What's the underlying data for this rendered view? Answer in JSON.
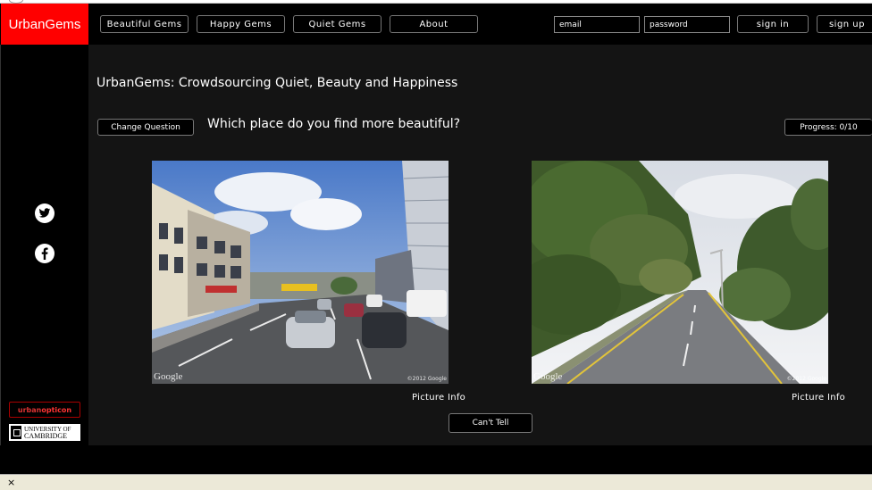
{
  "brand": {
    "name": "UrbanGems"
  },
  "nav": {
    "items": [
      {
        "label": "Beautiful Gems"
      },
      {
        "label": "Happy Gems"
      },
      {
        "label": "Quiet Gems"
      },
      {
        "label": "About"
      }
    ]
  },
  "auth": {
    "email_value": "email",
    "password_value": "password",
    "signin_label": "sign in",
    "signup_label": "sign up"
  },
  "social": {
    "twitter_icon": "twitter-icon",
    "facebook_icon": "facebook-icon"
  },
  "main": {
    "title": "UrbanGems: Crowdsourcing Quiet, Beauty and Happiness",
    "change_question_label": "Change Question",
    "question": "Which place do you find more beautiful?",
    "progress_label": "Progress: 0/10",
    "left_picture": {
      "watermark": "Google",
      "copyright": "©2012 Google",
      "info_label": "Picture Info"
    },
    "right_picture": {
      "watermark": "Google",
      "copyright": "©2012 Google",
      "info_label": "Picture Info"
    },
    "cant_tell_label": "Can't Tell"
  },
  "footer_logos": {
    "urbanopticon_a": "urban",
    "urbanopticon_b": "opticon",
    "cambridge_line1": "UNIVERSITY OF",
    "cambridge_line2": "CAMBRIDGE"
  },
  "statusbar": {
    "close_glyph": "×"
  },
  "colors": {
    "brand_red": "#ff0000",
    "panel": "#141414",
    "background": "#000000"
  }
}
